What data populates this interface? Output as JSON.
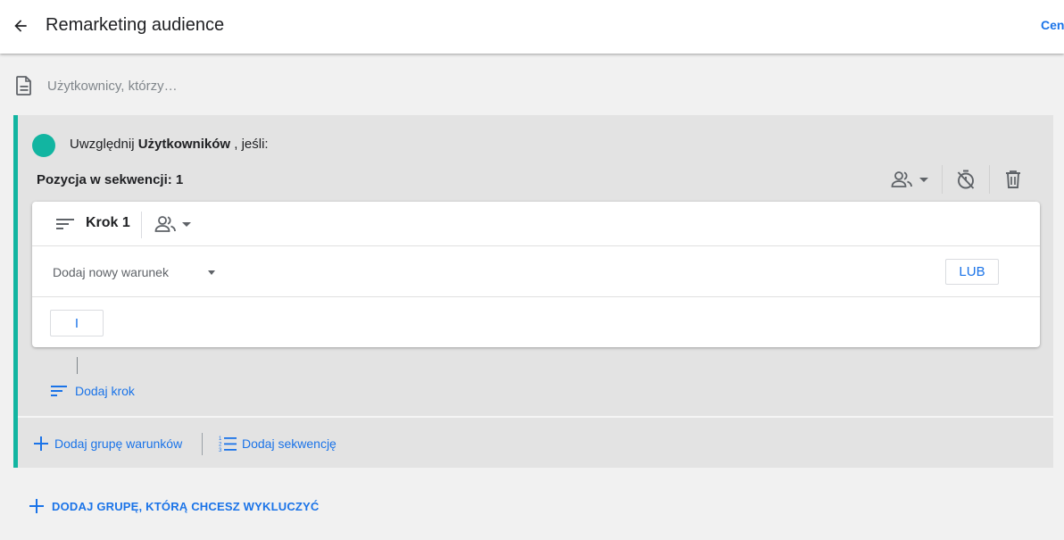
{
  "header": {
    "title": "Remarketing audience",
    "right_link": "Cent",
    "back_icon": "arrow-back-icon"
  },
  "description": {
    "placeholder": "Użytkownicy, którzy…",
    "icon": "document-icon"
  },
  "include_group": {
    "accent_color": "#12b5a1",
    "prefix": "Uwzględnij",
    "scope": "Użytkowników",
    "suffix": ", jeśli:",
    "sequence": {
      "label": "Pozycja w sekwencji: 1",
      "tools": [
        "users-dropdown-icon",
        "timer-off-icon",
        "delete-icon"
      ],
      "step": {
        "label": "Krok 1",
        "scope_icon": "users-icon",
        "condition_placeholder": "Dodaj nowy warunek",
        "or_label": "LUB",
        "and_label": "I"
      },
      "add_step_label": "Dodaj krok"
    },
    "footer": {
      "add_condition_group": "Dodaj grupę warunków",
      "add_sequence": "Dodaj sekwencję"
    }
  },
  "exclude": {
    "label": "DODAJ GRUPĘ, KTÓRĄ CHCESZ WYKLUCZYĆ"
  },
  "colors": {
    "accent": "#12b5a1",
    "link": "#1a73e8",
    "background": "#f1f1f1",
    "group_background": "#e3e3e3"
  }
}
